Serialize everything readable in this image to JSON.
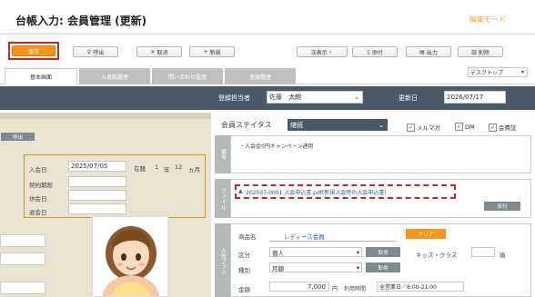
{
  "header": {
    "title": "台帳入力: 会員管理 (更新)",
    "mode": "編集モード"
  },
  "toolbar": {
    "save": "保存",
    "call": "呼出",
    "cancel": "取消",
    "new": "新規",
    "next": "次表示",
    "doc": "添付",
    "output": "出力",
    "delete": "削除"
  },
  "tabs": [
    "基本画面",
    "入退館履歴",
    "問い合わせ履歴",
    "進級履歴"
  ],
  "device_select": "デスクトップ",
  "registration": {
    "staff_label": "登録担当者",
    "staff_value": "佐藤　太朗",
    "date_label": "更新日",
    "date_value": "2026/07/17"
  },
  "left": {
    "header_badge": "呼出",
    "join_date_label": "入会日",
    "join_date_value": "2025/07/05",
    "tenure_label": "在籍",
    "tenure_years": "1",
    "year_unit": "年",
    "tenure_months": "12",
    "month_unit": "ヵ月",
    "contract_label": "契約期限",
    "leave_label": "休会日",
    "withdraw_label": "退会日"
  },
  "status": {
    "label": "会員ステイタス",
    "value": "継続",
    "checks": [
      {
        "label": "メルマガ",
        "checked": true
      },
      {
        "label": "DM",
        "checked": true
      },
      {
        "label": "会費証",
        "checked": true
      }
    ]
  },
  "remarks": {
    "side": "備考",
    "text": "・入会金0円キャンペーン適用"
  },
  "file": {
    "side": "ファイル",
    "link": "202507-0001 入会申込書.pdf(新規入会時の入会申込書)",
    "attach": "添付"
  },
  "plan": {
    "side": "入会プラン",
    "product_label": "商品名",
    "product_value": "レディース会員",
    "clear": "クリア",
    "category_label": "区分",
    "category_value": "個人",
    "acquire": "取得",
    "kids_label": "キッズ・クラス",
    "kids_unit": "級",
    "type_label": "種別",
    "type_value": "月額",
    "amount_label": "金額",
    "amount_value": "7,000",
    "yen": "円",
    "time_label": "利用時間",
    "time_value": "全営業日／8:00-21:00"
  }
}
